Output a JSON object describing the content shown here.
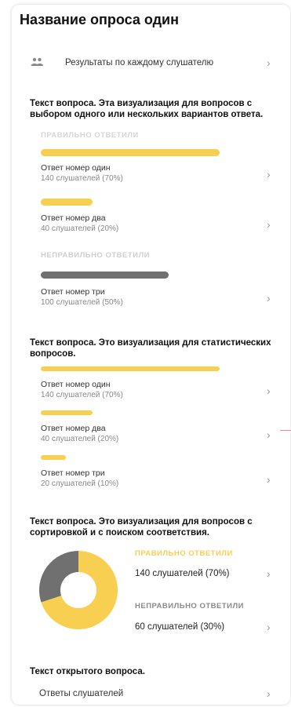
{
  "page": {
    "title": "Название опроса один",
    "results_link": "Результаты по каждому слушателю"
  },
  "q1": {
    "title": "Текст вопроса. Эта визуализация для вопросов с выбором одного или нескольких вариантов ответа.",
    "correct_label": "ПРАВИЛЬНО ОТВЕТИЛИ",
    "wrong_label": "НЕПРАВИЛЬНО ОТВЕТИЛИ",
    "answers": [
      {
        "label": "Ответ номер один",
        "sub": "140 слушателей (70%)",
        "pct": 70
      },
      {
        "label": "Ответ номер два",
        "sub": "40 слушателей (20%)",
        "pct": 20
      },
      {
        "label": "Ответ номер три",
        "sub": "100 слушателей (50%)",
        "pct": 50
      }
    ]
  },
  "q2": {
    "title": "Текст вопроса. Это визуализация для статистических вопросов.",
    "answers": [
      {
        "label": "Ответ номер один",
        "sub": "140 слушателей (70%)",
        "pct": 70
      },
      {
        "label": "Ответ номер два",
        "sub": "40 слушателей (20%)",
        "pct": 20
      },
      {
        "label": "Ответ номер три",
        "sub": "20 слушателей (10%)",
        "pct": 10
      }
    ]
  },
  "q3": {
    "title": "Текст вопроса. Это визуализация для вопросов с сортировкой и с поиском соответствия.",
    "correct_label": "ПРАВИЛЬНО ОТВЕТИЛИ",
    "correct_value": "140 слушателей (70%)",
    "wrong_label": "НЕПРАВИЛЬНО ОТВЕТИЛИ",
    "wrong_value": "60 слушателей (30%)"
  },
  "q4": {
    "title": "Текст открытого вопроса.",
    "link": "Ответы слушателей"
  },
  "icons": {
    "chevron": "›",
    "people": "people-icon"
  },
  "colors": {
    "accent": "#f9cf52",
    "gray": "#707070",
    "correct_label": "#f9cf52",
    "wrong_label": "#8a8a8a"
  },
  "chart_data": {
    "type": "pie",
    "categories": [
      "ПРАВИЛЬНО ОТВЕТИЛИ",
      "НЕПРАВИЛЬНО ОТВЕТИЛИ"
    ],
    "values": [
      70,
      30
    ],
    "colors": [
      "#f9cf52",
      "#707070"
    ]
  }
}
